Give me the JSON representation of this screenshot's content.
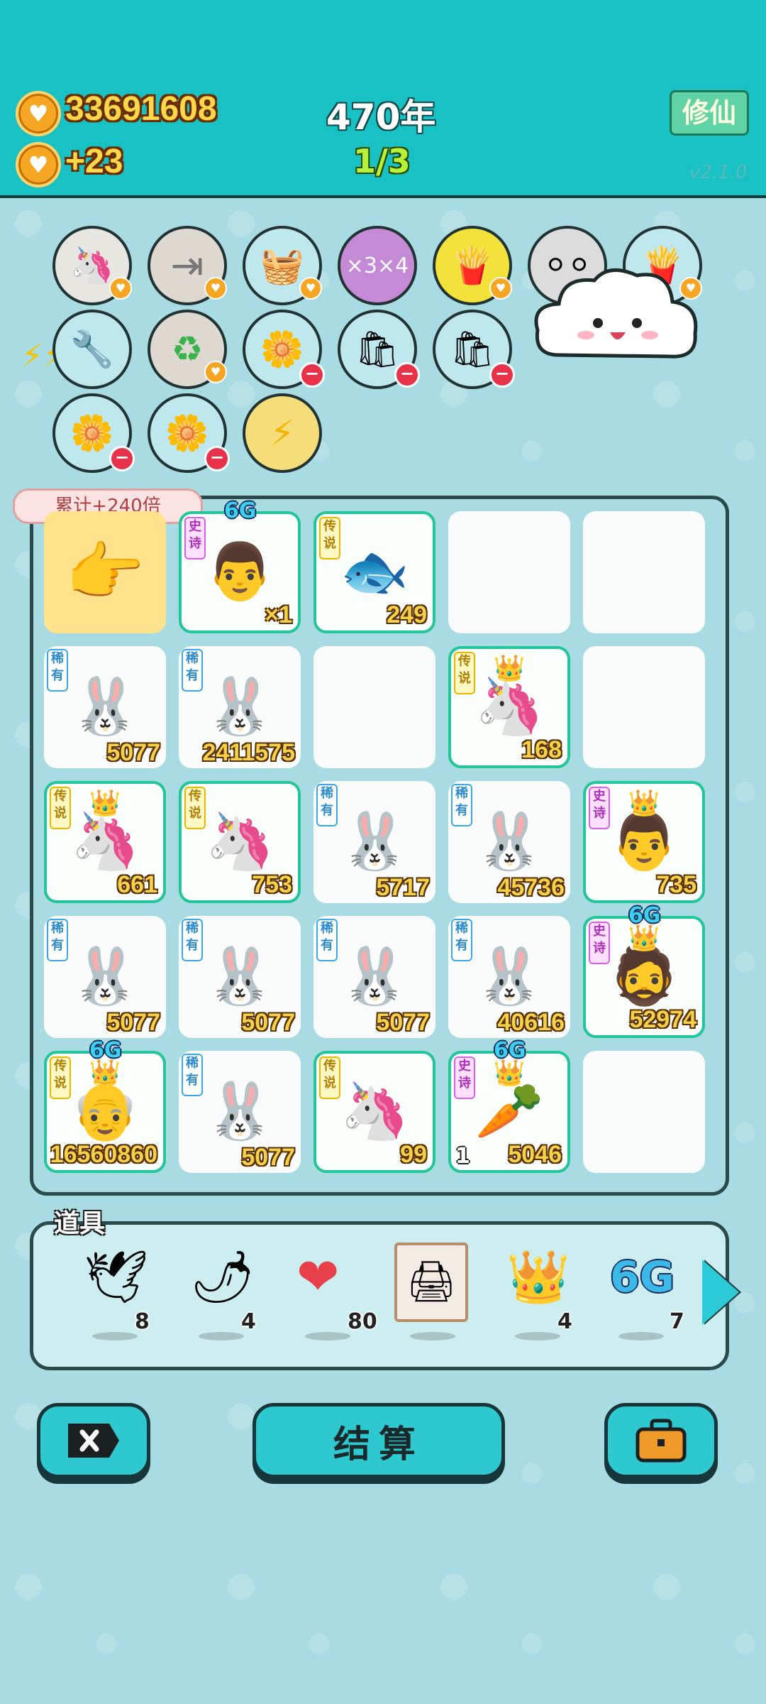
{
  "header": {
    "coins": "33691608",
    "coin_rate": "+23",
    "year": "470年",
    "stage": "1/3",
    "xiuxian_label": "修仙",
    "version": "v2.1.0"
  },
  "skills": {
    "row1": [
      "unicorn-pair-icon",
      "skip-icon",
      "basket-icon",
      "multiplier-icon",
      "fries-icon",
      "egg-tray-icon",
      "fries-icon"
    ],
    "row2": [
      "pump-icon",
      "refresh-icon",
      "flower-pot-icon",
      "bag-icon",
      "bag-icon"
    ],
    "row3": [
      "flower-pot-icon",
      "flower-pot-icon",
      "lightning-icon"
    ]
  },
  "board": {
    "total_bonus": "累计+240倍",
    "cells": [
      {
        "type": "pointer"
      },
      {
        "type": "face",
        "rarity": "史诗",
        "count": "×1",
        "sixg": "6G"
      },
      {
        "type": "fish",
        "rarity": "传说",
        "count": "249"
      },
      {
        "type": "empty"
      },
      {
        "type": "empty"
      },
      {
        "type": "rabbit",
        "rarity": "稀有",
        "count": "5077"
      },
      {
        "type": "rabbit-fire",
        "rarity": "稀有",
        "count": "2411575"
      },
      {
        "type": "empty"
      },
      {
        "type": "unicorn",
        "rarity": "传说",
        "count": "168",
        "crown": true
      },
      {
        "type": "empty"
      },
      {
        "type": "unicorn",
        "rarity": "传说",
        "count": "661",
        "crown": true
      },
      {
        "type": "unicorn",
        "rarity": "传说",
        "count": "753"
      },
      {
        "type": "rabbit",
        "rarity": "稀有",
        "count": "5717"
      },
      {
        "type": "rabbit",
        "rarity": "稀有",
        "count": "45736"
      },
      {
        "type": "face",
        "rarity": "史诗",
        "count": "735",
        "crown": true
      },
      {
        "type": "rabbit",
        "rarity": "稀有",
        "count": "5077"
      },
      {
        "type": "rabbit",
        "rarity": "稀有",
        "count": "5077"
      },
      {
        "type": "rabbit",
        "rarity": "稀有",
        "count": "5077"
      },
      {
        "type": "rabbit",
        "rarity": "稀有",
        "count": "40616"
      },
      {
        "type": "face-glasses",
        "rarity": "史诗",
        "count": "52974",
        "sixg": "6G",
        "crown": true
      },
      {
        "type": "old-face",
        "rarity": "传说",
        "count": "16560860",
        "sixg": "6G",
        "crown": true
      },
      {
        "type": "rabbit",
        "rarity": "稀有",
        "count": "5077"
      },
      {
        "type": "unicorn",
        "rarity": "传说",
        "count": "99"
      },
      {
        "type": "carrot",
        "rarity": "史诗",
        "count": "5046",
        "sixg": "6G",
        "crown": true,
        "level": "1"
      },
      {
        "type": "empty"
      }
    ]
  },
  "props": {
    "title": "道具",
    "items": [
      {
        "icon": "bird-icon",
        "count": "8"
      },
      {
        "icon": "pepper-icon",
        "count": "4"
      },
      {
        "icon": "liver-icon",
        "count": "80"
      },
      {
        "icon": "printer-icon",
        "count": ""
      },
      {
        "icon": "crown-icon",
        "count": "4"
      },
      {
        "icon": "6g-icon",
        "label": "6G",
        "count": "7"
      }
    ]
  },
  "buttons": {
    "settle": "结算"
  }
}
